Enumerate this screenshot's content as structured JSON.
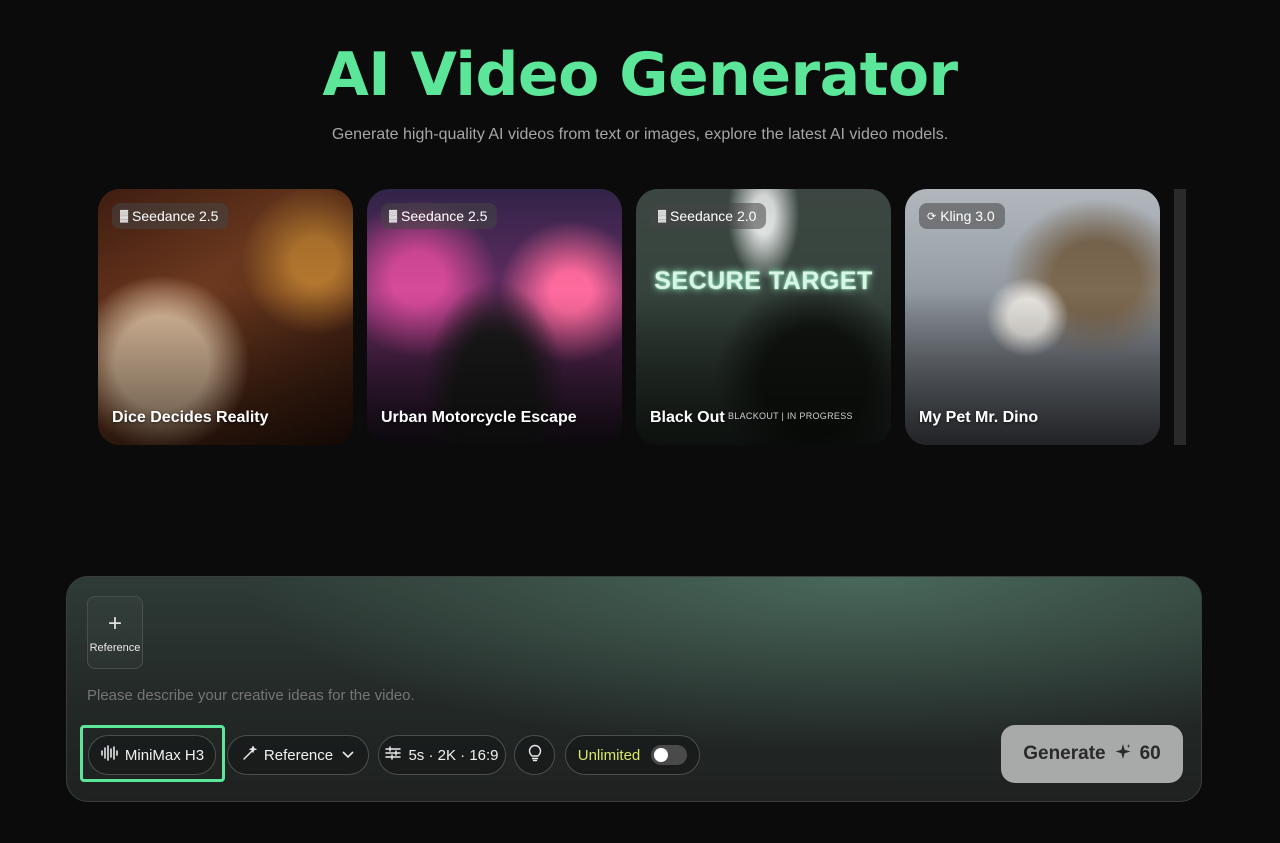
{
  "hero": {
    "title": "AI Video Generator",
    "subtitle": "Generate high-quality AI videos from text or images, explore the latest AI video models."
  },
  "cards": [
    {
      "model": "Seedance 2.5",
      "model_icon": "bars-icon",
      "title": "Dice Decides Reality"
    },
    {
      "model": "Seedance 2.5",
      "model_icon": "bars-icon",
      "title": "Urban Motorcycle Escape"
    },
    {
      "model": "Seedance 2.0",
      "model_icon": "bars-icon",
      "title": "Black Out",
      "overlay_text": "SECURE TARGET",
      "caption": "BLACKOUT | IN PROGRESS"
    },
    {
      "model": "Kling 3.0",
      "model_icon": "kling-icon",
      "title": "My Pet Mr. Dino"
    }
  ],
  "panel": {
    "reference_tile": {
      "icon": "plus-icon",
      "label": "Reference"
    },
    "prompt_placeholder": "Please describe your creative ideas for the video.",
    "toolbar": {
      "model": {
        "label": "MiniMax H3",
        "icon": "waveform-icon"
      },
      "mode": {
        "label": "Reference",
        "icon": "magic-wand-icon"
      },
      "settings": {
        "label": "5s · 2K · 16:9",
        "icon": "sliders-icon"
      },
      "idea": {
        "icon": "lightbulb-icon"
      },
      "unlimited": {
        "label": "Unlimited",
        "enabled": false
      }
    },
    "generate": {
      "label": "Generate",
      "cost": "60",
      "icon": "sparkle-icon"
    }
  },
  "colors": {
    "accent": "#5ce69a",
    "unlimited_text": "#d6e86a",
    "generate_bg": "#a8aaa9"
  }
}
